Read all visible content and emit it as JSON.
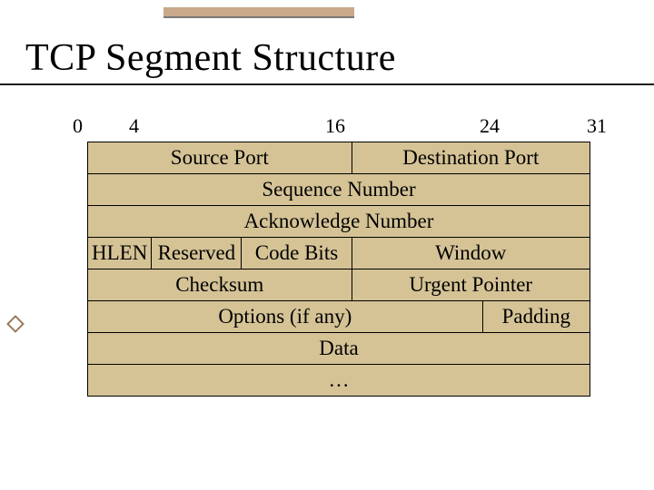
{
  "title": "TCP  Segment Structure",
  "bit_labels": {
    "b0": "0",
    "b4": "4",
    "b16": "16",
    "b24": "24",
    "b31": "31"
  },
  "rows": {
    "source_port": "Source Port",
    "dest_port": "Destination Port",
    "sequence": "Sequence Number",
    "ack": "Acknowledge Number",
    "hlen": "HLEN",
    "reserved": "Reserved",
    "code_bits": "Code Bits",
    "window": "Window",
    "checksum": "Checksum",
    "urgent": "Urgent Pointer",
    "options": "Options (if any)",
    "padding": "Padding",
    "data": "Data",
    "more": "…"
  }
}
